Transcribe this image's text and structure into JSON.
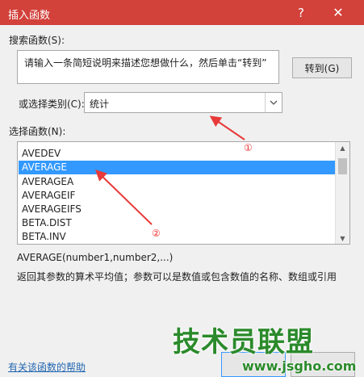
{
  "window": {
    "title": "插入函数",
    "help_glyph": "?",
    "close_glyph": "✕"
  },
  "search": {
    "label": "搜索函数(S):",
    "value": "请输入一条简短说明来描述您想做什么，然后单击“转到”",
    "goto_label": "转到(G)"
  },
  "category": {
    "label": "或选择类别(C):",
    "selected": "统计"
  },
  "functions": {
    "label": "选择函数(N):",
    "items": [
      "AVEDEV",
      "AVERAGE",
      "AVERAGEA",
      "AVERAGEIF",
      "AVERAGEIFS",
      "BETA.DIST",
      "BETA.INV"
    ],
    "selected": "AVERAGE"
  },
  "details": {
    "syntax": "AVERAGE(number1,number2,...)",
    "description": "返回其参数的算术平均值；参数可以是数值或包含数值的名称、数组或引用"
  },
  "footer": {
    "help_link": "有关该函数的帮助"
  },
  "annotations": {
    "marker_1": "①",
    "marker_2": "②",
    "arrow_color": "#e83a3a"
  },
  "watermark": {
    "brand": "技术员联盟",
    "url": "www.jsgho.com"
  },
  "colors": {
    "titlebar": "#d2413a",
    "selection": "#3399ff",
    "link": "#2366b1",
    "watermark": "#2b8a2b"
  }
}
